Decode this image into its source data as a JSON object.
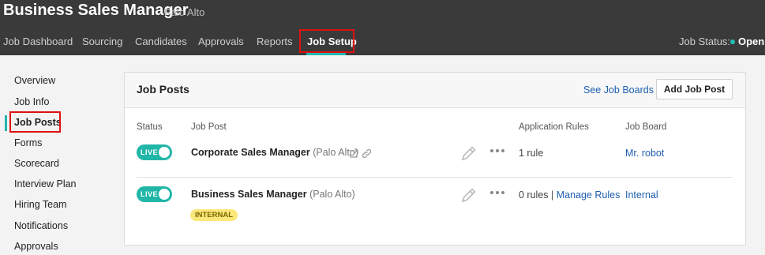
{
  "header": {
    "title": "Business Sales Manager",
    "subtitle": "Palo Alto",
    "nav": [
      "Job Dashboard",
      "Sourcing",
      "Candidates",
      "Approvals",
      "Reports",
      "Job Setup"
    ],
    "status_label": "Job Status:",
    "status_value": "Open"
  },
  "sidebar": {
    "items": [
      "Overview",
      "Job Info",
      "Job Posts",
      "Forms",
      "Scorecard",
      "Interview Plan",
      "Hiring Team",
      "Notifications",
      "Approvals"
    ],
    "active": "Job Posts"
  },
  "card": {
    "title": "Job Posts",
    "see_boards": "See Job Boards",
    "add_button": "Add Job Post",
    "columns": [
      "Status",
      "Job Post",
      "Application Rules",
      "Job Board"
    ],
    "rows": [
      {
        "status": "LIVE",
        "name": "Corporate Sales Manager",
        "location": "(Palo Alto)",
        "rules": "1 rule",
        "board": "Mr. robot"
      },
      {
        "status": "LIVE",
        "name": "Business Sales Manager",
        "location": "(Palo Alto)",
        "badge": "INTERNAL",
        "rules": "0 rules",
        "rules_sep": "|",
        "manage_rules": "Manage Rules",
        "board": "Internal"
      }
    ]
  },
  "colors": {
    "header_bg": "#3a3a3a",
    "accent": "#21b6b0",
    "link": "#1f5fb0",
    "highlight": "#e01010",
    "badge": "#fbe87a"
  }
}
